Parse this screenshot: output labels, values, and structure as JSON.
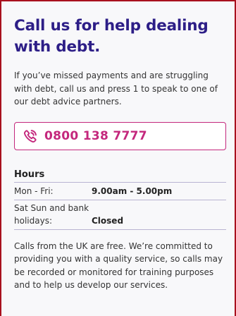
{
  "card": {
    "title": "Call us for help dealing with debt.",
    "intro": "If you’ve missed payments and are struggling with debt, call us and press 1 to speak to one of our debt advice partners.",
    "phone": {
      "icon": "phone-icon",
      "number": "0800 138 7777"
    },
    "hours": {
      "heading": "Hours",
      "rows": [
        {
          "days": "Mon - Fri:",
          "time": "9.00am - 5.00pm"
        },
        {
          "days": "Sat Sun and bank holidays:",
          "time": "Closed"
        }
      ]
    },
    "footer": "Calls from the UK are free. We’re committed to providing you with a quality service, so calls may be recorded or monitored for training purposes and to help us develop our services."
  },
  "colors": {
    "title": "#2d1e87",
    "accent": "#c4287d",
    "border": "#a8101e",
    "divider": "#b9b4d2"
  }
}
